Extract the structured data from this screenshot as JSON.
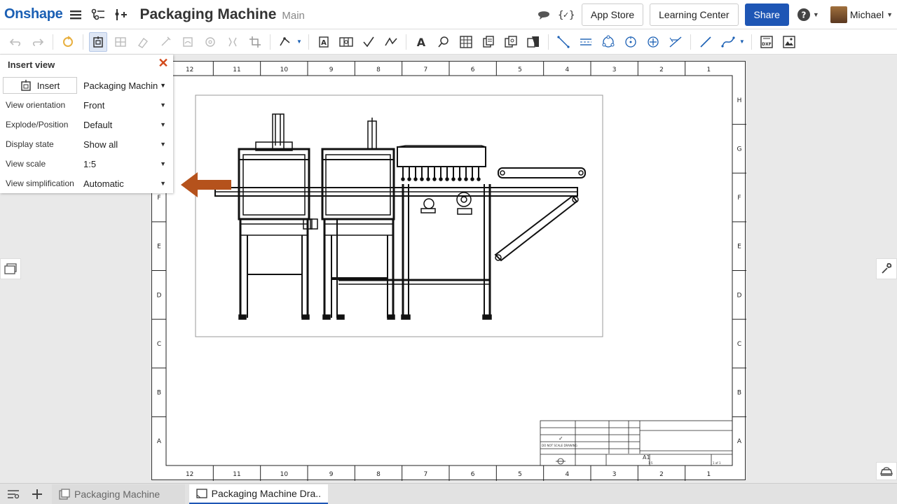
{
  "header": {
    "logo": "Onshape",
    "document_title": "Packaging Machine",
    "branch": "Main",
    "app_store": "App Store",
    "learning_center": "Learning Center",
    "share": "Share",
    "user_name": "Michael"
  },
  "insert_view": {
    "title": "Insert view",
    "insert_label": "Insert",
    "source_value": "Packaging Machin",
    "rows": [
      {
        "label": "View orientation",
        "value": "Front"
      },
      {
        "label": "Explode/Position",
        "value": "Default"
      },
      {
        "label": "Display state",
        "value": "Show all"
      },
      {
        "label": "View scale",
        "value": "1:5"
      },
      {
        "label": "View simplification",
        "value": "Automatic"
      }
    ]
  },
  "sheet": {
    "column_labels": [
      "12",
      "11",
      "10",
      "9",
      "8",
      "7",
      "6",
      "5",
      "4",
      "3",
      "2",
      "1"
    ],
    "row_labels": [
      "H",
      "G",
      "F",
      "E",
      "D",
      "C",
      "B",
      "A"
    ],
    "sheet_size": "A1",
    "scale_note": "1:5",
    "sheet_number": "1 of 1",
    "do_not_scale": "DO NOT SCALE DRAWING"
  },
  "tabs": [
    {
      "label": "Packaging Machine"
    },
    {
      "label": "Packaging Machine Dra..."
    }
  ],
  "colors": {
    "brand": "#1a5fb4",
    "share_button": "#1e56b5",
    "close_x": "#d34a1b",
    "arrow": "#b5521c"
  }
}
